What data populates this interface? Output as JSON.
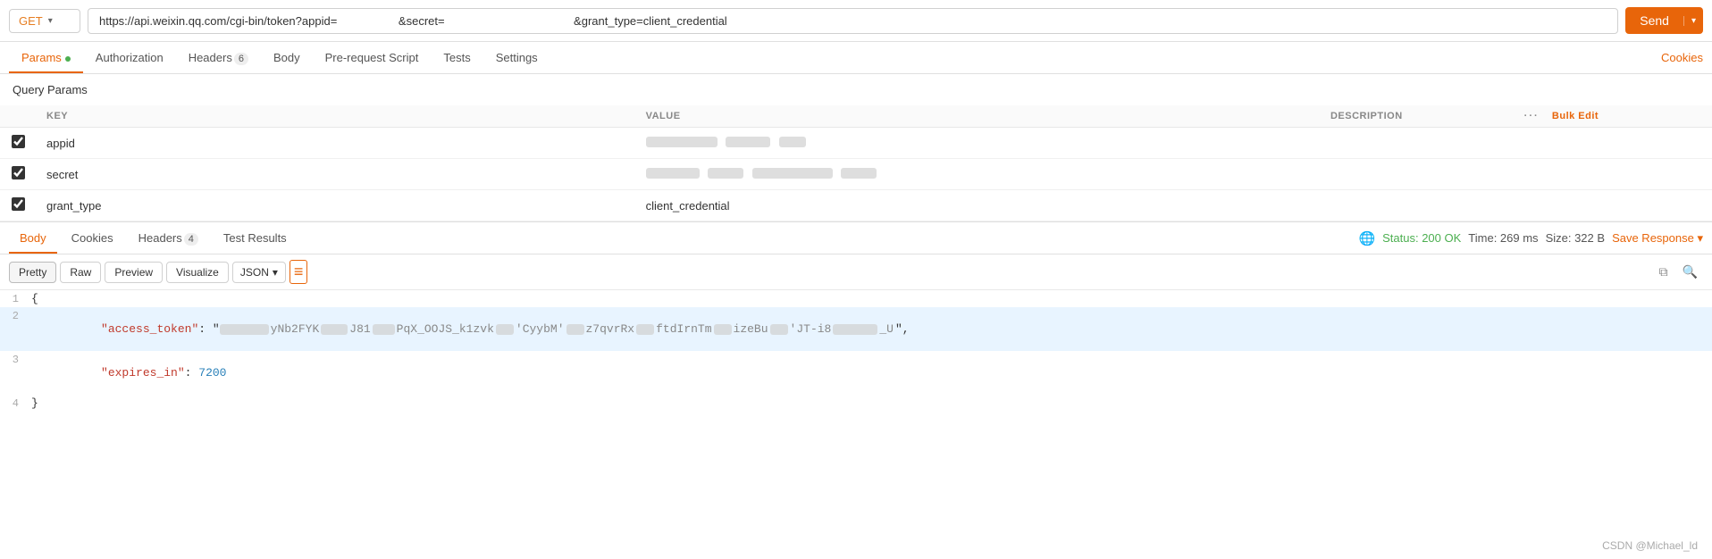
{
  "url_bar": {
    "method": "GET",
    "chevron": "▾",
    "url": "https://api.weixin.qq.com/cgi-bin/token?appid=█████████████&secret=█████████████████████&grant_type=client_credential",
    "url_display": "https://api.weixin.qq.com/cgi-bin/token?appid=                   &secret=                                        &grant_type=client_credential",
    "send_label": "Send",
    "send_dropdown": "▾"
  },
  "tabs": {
    "params_label": "Params",
    "authorization_label": "Authorization",
    "headers_label": "Headers",
    "headers_badge": "6",
    "body_label": "Body",
    "prerequest_label": "Pre-request Script",
    "tests_label": "Tests",
    "settings_label": "Settings",
    "cookies_label": "Cookies"
  },
  "query_params": {
    "section_title": "Query Params",
    "columns": {
      "key": "KEY",
      "value": "VALUE",
      "description": "DESCRIPTION",
      "more": "···",
      "bulk_edit": "Bulk Edit"
    },
    "rows": [
      {
        "checked": true,
        "key": "appid",
        "value_blurred": true,
        "value": ""
      },
      {
        "checked": true,
        "key": "secret",
        "value_blurred": true,
        "value": ""
      },
      {
        "checked": true,
        "key": "grant_type",
        "value_blurred": false,
        "value": "client_credential"
      }
    ]
  },
  "response": {
    "tabs": {
      "body_label": "Body",
      "cookies_label": "Cookies",
      "headers_label": "Headers",
      "headers_badge": "4",
      "test_results_label": "Test Results"
    },
    "meta": {
      "status": "Status: 200 OK",
      "time": "Time: 269 ms",
      "size": "Size: 322 B"
    },
    "save_response": "Save Response",
    "save_dropdown": "▾"
  },
  "code_view": {
    "pretty_label": "Pretty",
    "raw_label": "Raw",
    "preview_label": "Preview",
    "visualize_label": "Visualize",
    "format_label": "JSON",
    "format_dropdown": "▾",
    "wrap_icon": "≡",
    "lines": [
      {
        "num": "1",
        "content": "{"
      },
      {
        "num": "2",
        "content": "    \"access_token\": \""
      },
      {
        "num": "3",
        "content": "    \"expires_in\": 7200"
      },
      {
        "num": "4",
        "content": "}"
      }
    ]
  },
  "watermark": "CSDN @Michael_ld",
  "colors": {
    "orange": "#e8650a",
    "green": "#4caf50",
    "red": "#c0392b",
    "blue": "#2980b9"
  }
}
